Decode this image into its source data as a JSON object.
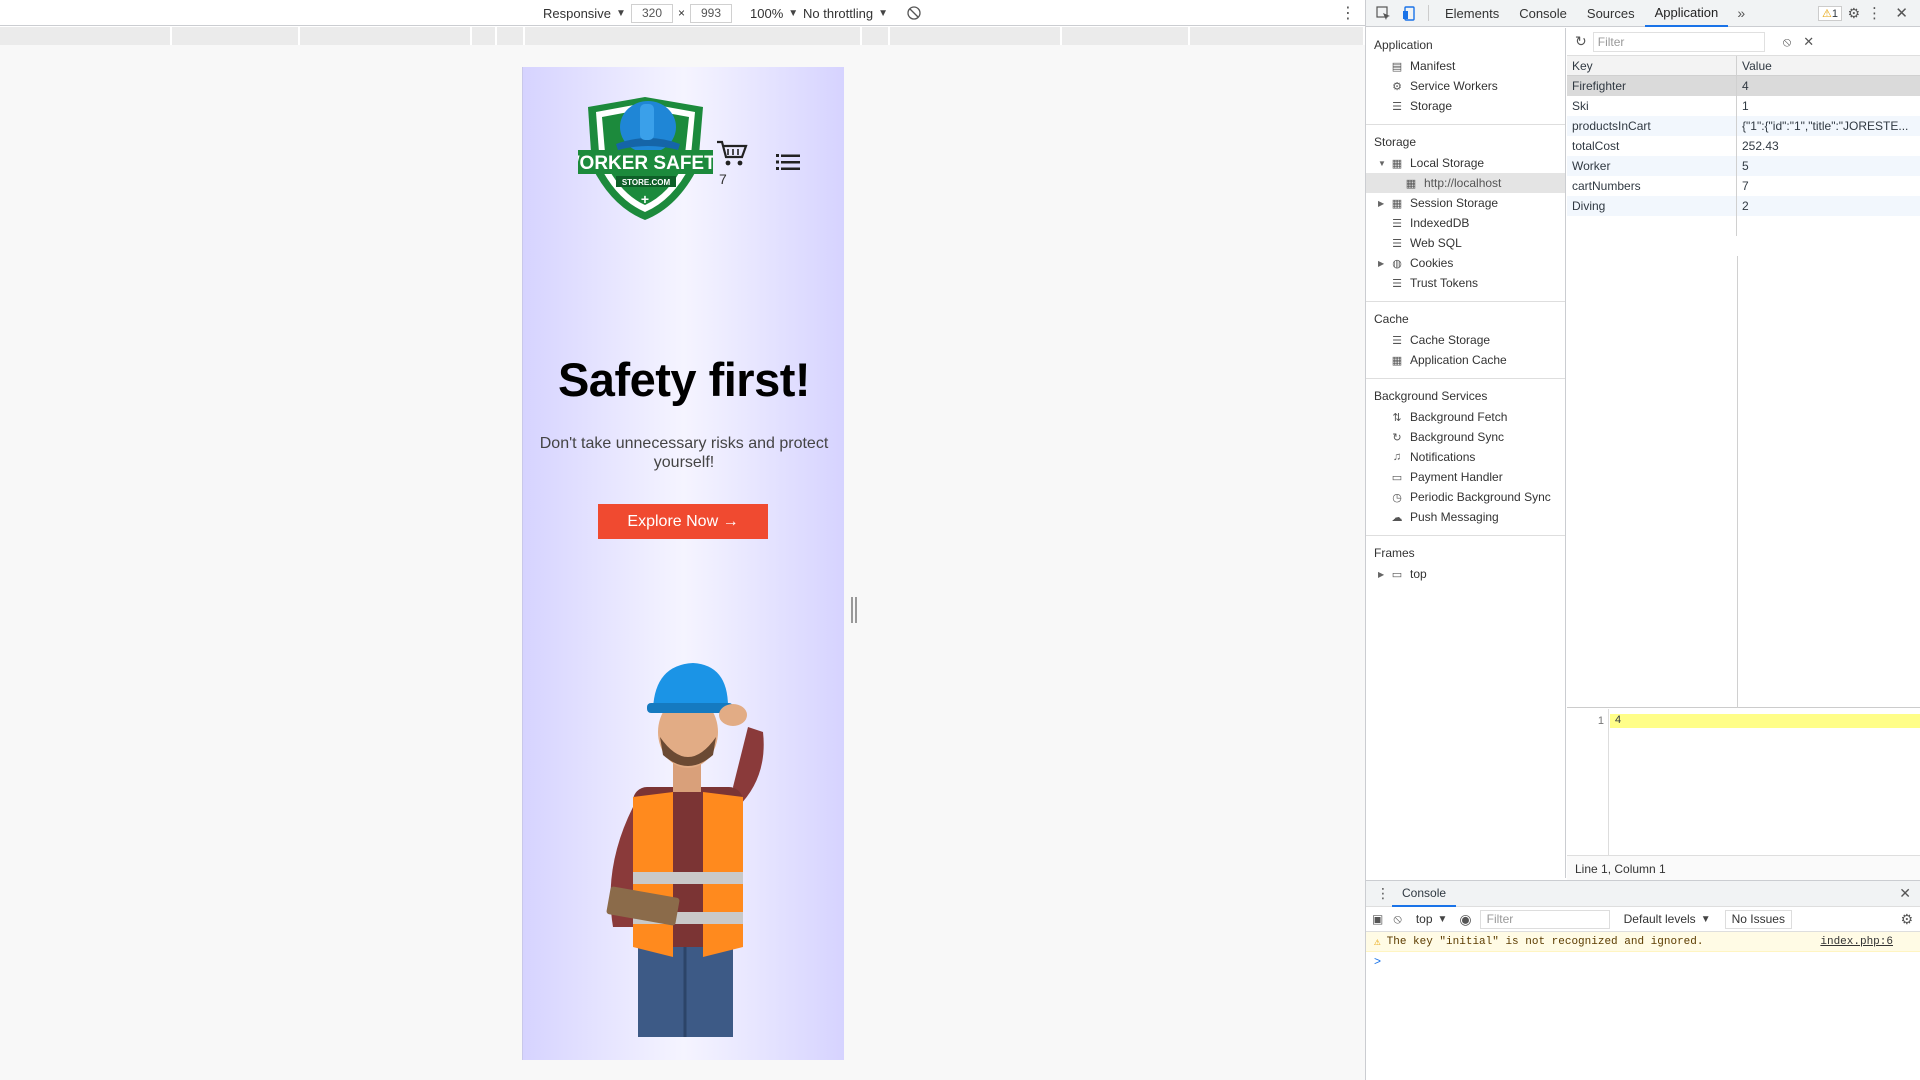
{
  "toolbar": {
    "device": "Responsive",
    "width": "320",
    "times": "×",
    "height": "993",
    "zoom": "100%",
    "throttle": "No throttling"
  },
  "page": {
    "cart_count": "7",
    "title": "Safety first!",
    "subtitle": "Don't take unnecessary risks and protect yourself!",
    "cta": "Explore Now →",
    "logo_text_1": "WORKER SAFETY",
    "logo_text_2": "STORE.COM"
  },
  "devtools": {
    "tabs": [
      "Elements",
      "Console",
      "Sources",
      "Application"
    ],
    "active_tab": "Application",
    "warning_count": "1",
    "sidebar": {
      "application_header": "Application",
      "application_items": [
        "Manifest",
        "Service Workers",
        "Storage"
      ],
      "storage_header": "Storage",
      "local_storage": "Local Storage",
      "local_origin": "http://localhost",
      "storage_items": [
        "Session Storage",
        "IndexedDB",
        "Web SQL",
        "Cookies",
        "Trust Tokens"
      ],
      "cache_header": "Cache",
      "cache_items": [
        "Cache Storage",
        "Application Cache"
      ],
      "bg_header": "Background Services",
      "bg_items": [
        "Background Fetch",
        "Background Sync",
        "Notifications",
        "Payment Handler",
        "Periodic Background Sync",
        "Push Messaging"
      ],
      "frames_header": "Frames",
      "frames_item": "top"
    },
    "filter_placeholder": "Filter",
    "table": {
      "key_header": "Key",
      "value_header": "Value",
      "rows": [
        {
          "key": "Firefighter",
          "value": "4"
        },
        {
          "key": "Ski",
          "value": "1"
        },
        {
          "key": "productsInCart",
          "value": "{\"1\":{\"id\":\"1\",\"title\":\"JORESTE..."
        },
        {
          "key": "totalCost",
          "value": "252.43"
        },
        {
          "key": "Worker",
          "value": "5"
        },
        {
          "key": "cartNumbers",
          "value": "7"
        },
        {
          "key": "Diving",
          "value": "2"
        }
      ]
    },
    "preview": {
      "line_no": "1",
      "content": "4"
    },
    "status": "Line 1, Column 1",
    "console": {
      "tab": "Console",
      "context": "top",
      "filter": "Filter",
      "levels": "Default levels",
      "issues": "No Issues",
      "message": "The key \"initial\" is not recognized and ignored.",
      "source": "index.php:6",
      "prompt": ">"
    }
  }
}
